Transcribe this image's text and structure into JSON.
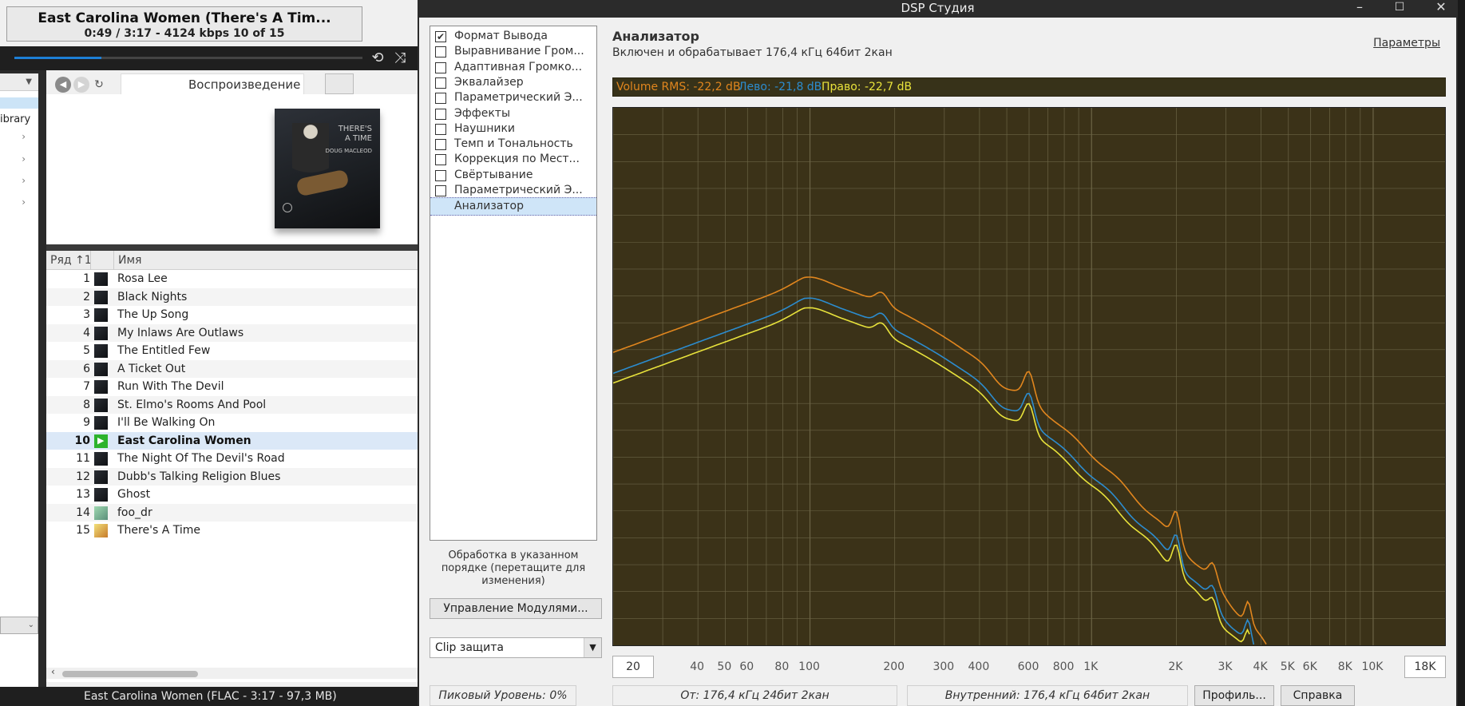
{
  "player": {
    "now_playing_title": "East Carolina Women (There's A Tim...",
    "now_playing_info": "0:49 / 3:17 - 4124 kbps  10 of 15",
    "progress_fraction": 0.25,
    "tree": {
      "library_label": "ibrary"
    },
    "toolbar": {
      "playback_label": "Воспроизведение ▾"
    },
    "album_art": {
      "text_line1": "THERE'S",
      "text_line2": "A TIME",
      "text_line3": "DOUG MACLEOD"
    },
    "list": {
      "col_number": "Ряд ↑1",
      "col_name": "Имя",
      "tracks": [
        {
          "num": "1",
          "title": "Rosa Lee"
        },
        {
          "num": "2",
          "title": "Black Nights"
        },
        {
          "num": "3",
          "title": "The Up Song"
        },
        {
          "num": "4",
          "title": "My Inlaws Are Outlaws"
        },
        {
          "num": "5",
          "title": "The Entitled Few"
        },
        {
          "num": "6",
          "title": "A Ticket Out"
        },
        {
          "num": "7",
          "title": "Run With The Devil"
        },
        {
          "num": "8",
          "title": "St. Elmo's Rooms And Pool"
        },
        {
          "num": "9",
          "title": "I'll Be Walking On"
        },
        {
          "num": "10",
          "title": "East Carolina Women"
        },
        {
          "num": "11",
          "title": "The Night Of The Devil's Road"
        },
        {
          "num": "12",
          "title": "Dubb's Talking Religion Blues"
        },
        {
          "num": "13",
          "title": "Ghost"
        },
        {
          "num": "14",
          "title": "foo_dr"
        },
        {
          "num": "15",
          "title": "There's A Time"
        }
      ]
    },
    "status_text": "East Carolina Women (FLAC - 3:17 - 97,3 MB)"
  },
  "dsp": {
    "window_title": "DSP Студия",
    "modules": [
      {
        "label": "Формат Вывода",
        "checked": true
      },
      {
        "label": "Выравнивание Гром...",
        "checked": false
      },
      {
        "label": "Адаптивная Громко...",
        "checked": false
      },
      {
        "label": "Эквалайзер",
        "checked": false
      },
      {
        "label": "Параметрический Э...",
        "checked": false
      },
      {
        "label": "Эффекты",
        "checked": false
      },
      {
        "label": "Наушники",
        "checked": false
      },
      {
        "label": "Темп и Тональность",
        "checked": false
      },
      {
        "label": "Коррекция по Мест...",
        "checked": false
      },
      {
        "label": "Свёртывание",
        "checked": false
      },
      {
        "label": "Параметрический Э...",
        "checked": false
      },
      {
        "label": "Анализатор",
        "checked": null
      }
    ],
    "order_note": "Обработка в указанном порядке (перетащите для изменения)",
    "manage_button": "Управление Модулями...",
    "clip_select": "Clip защита",
    "analyzer": {
      "title": "Анализатор",
      "subtitle": "Включен и обрабатывает 176,4 кГц 64бит 2кан",
      "params_link": "Параметры",
      "rms_all": "Volume RMS: -22,2 dB",
      "rms_left": "Лево: -21,8 dB",
      "rms_right": "Право: -22,7 dB",
      "colors": {
        "all": "#e1861e",
        "left": "#2c8ccf",
        "right": "#e8e23b",
        "background": "#3b3218",
        "grid": "#6b6446"
      },
      "freq_min": "20",
      "freq_max": "18K",
      "freq_ticks": [
        "40",
        "50",
        "60",
        "80",
        "100",
        "200",
        "300",
        "400",
        "600",
        "800",
        "1K",
        "2K",
        "3K",
        "4K",
        "5K",
        "6K",
        "8K",
        "10K"
      ]
    },
    "status": {
      "peak": "Пиковый Уровень: 0%",
      "from": "От: 176,4 кГц 24бит 2кан",
      "internal": "Внутренний: 176,4 кГц 64бит 2кан",
      "profile_button": "Профиль...",
      "help_button": "Справка"
    }
  }
}
